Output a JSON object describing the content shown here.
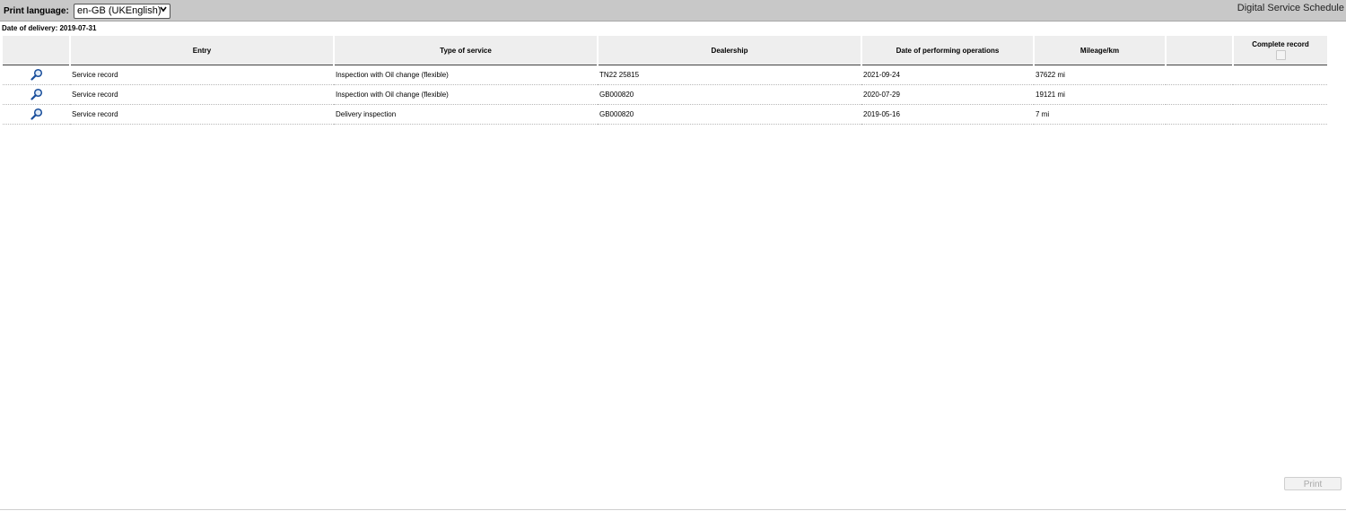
{
  "header": {
    "print_language_label": "Print language:",
    "language_selected": "en-GB (UKEnglish)",
    "app_title": "Digital Service Schedule"
  },
  "delivery": {
    "label": "Date of delivery:",
    "value": "2019-07-31"
  },
  "table": {
    "columns": {
      "entry": "Entry",
      "type": "Type of service",
      "dealership": "Dealership",
      "date": "Date of performing operations",
      "mileage": "Mileage/km",
      "blank": "",
      "complete": "Complete record"
    },
    "rows": [
      {
        "entry": "Service record",
        "type": "Inspection with Oil change (flexible)",
        "dealership": "TN22 25815",
        "date": "2021-09-24",
        "mileage": "37622 mi"
      },
      {
        "entry": "Service record",
        "type": "Inspection with Oil change (flexible)",
        "dealership": "GB000820",
        "date": "2020-07-29",
        "mileage": "19121 mi"
      },
      {
        "entry": "Service record",
        "type": "Delivery inspection",
        "dealership": "GB000820",
        "date": "2019-05-16",
        "mileage": "7 mi"
      }
    ]
  },
  "footer": {
    "print_label": "Print"
  },
  "icons": {
    "row_view": "magnifier-icon",
    "select": "chevron-down-icon"
  },
  "colors": {
    "topbar": "#c8c8c8",
    "header_cell": "#eeeeee",
    "icon_blue": "#1a4f9c"
  }
}
